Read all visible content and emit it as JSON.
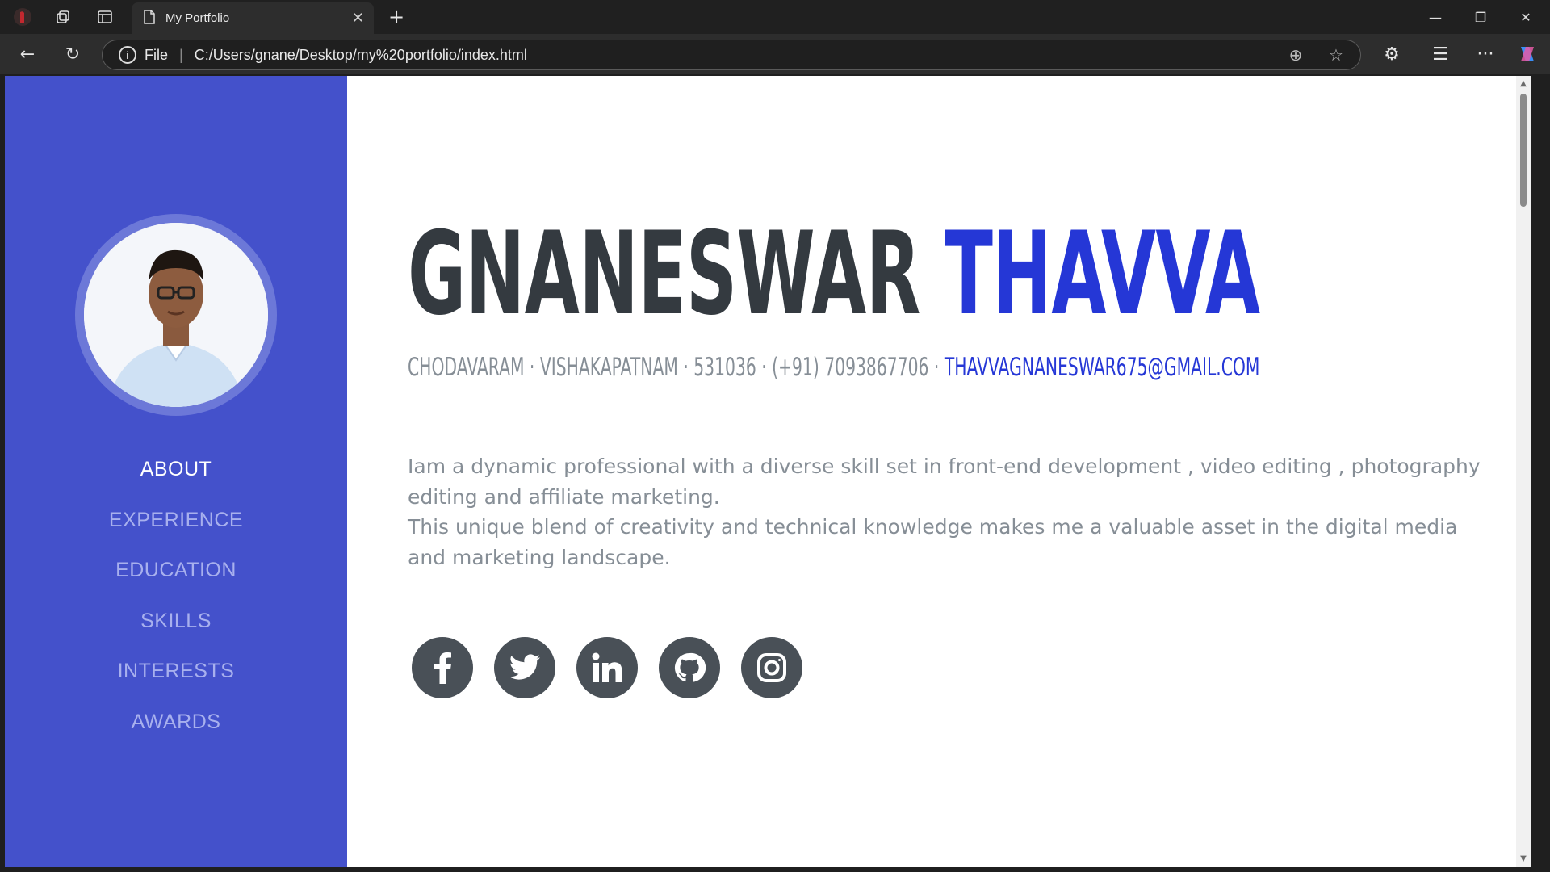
{
  "browser": {
    "tab_title": "My Portfolio",
    "address_scheme": "File",
    "address_path": "C:/Users/gnane/Desktop/my%20portfolio/index.html"
  },
  "profile": {
    "first_name": "GNANESWAR",
    "last_name": "THAVVA",
    "contact_text": "CHODAVARAM · VISHAKAPATNAM · 531036 · (+91) 7093867706 · ",
    "email": "THAVVAGNANESWAR675@GMAIL.COM",
    "bio_line1": "Iam a dynamic professional with a diverse skill set in front-end development , video editing , photography editing and affiliate marketing.",
    "bio_line2": "This unique blend of creativity and technical knowledge makes me a valuable asset in the digital media and marketing landscape."
  },
  "sidebar": {
    "items": [
      {
        "label": "ABOUT"
      },
      {
        "label": "EXPERIENCE"
      },
      {
        "label": "EDUCATION"
      },
      {
        "label": "SKILLS"
      },
      {
        "label": "INTERESTS"
      },
      {
        "label": "AWARDS"
      }
    ],
    "accent_color": "#4451cb"
  },
  "social": [
    "facebook-icon",
    "twitter-icon",
    "linkedin-icon",
    "github-icon",
    "instagram-icon"
  ],
  "colors": {
    "primary": "#2537d6",
    "heading": "#343a40",
    "muted": "#868e96"
  }
}
